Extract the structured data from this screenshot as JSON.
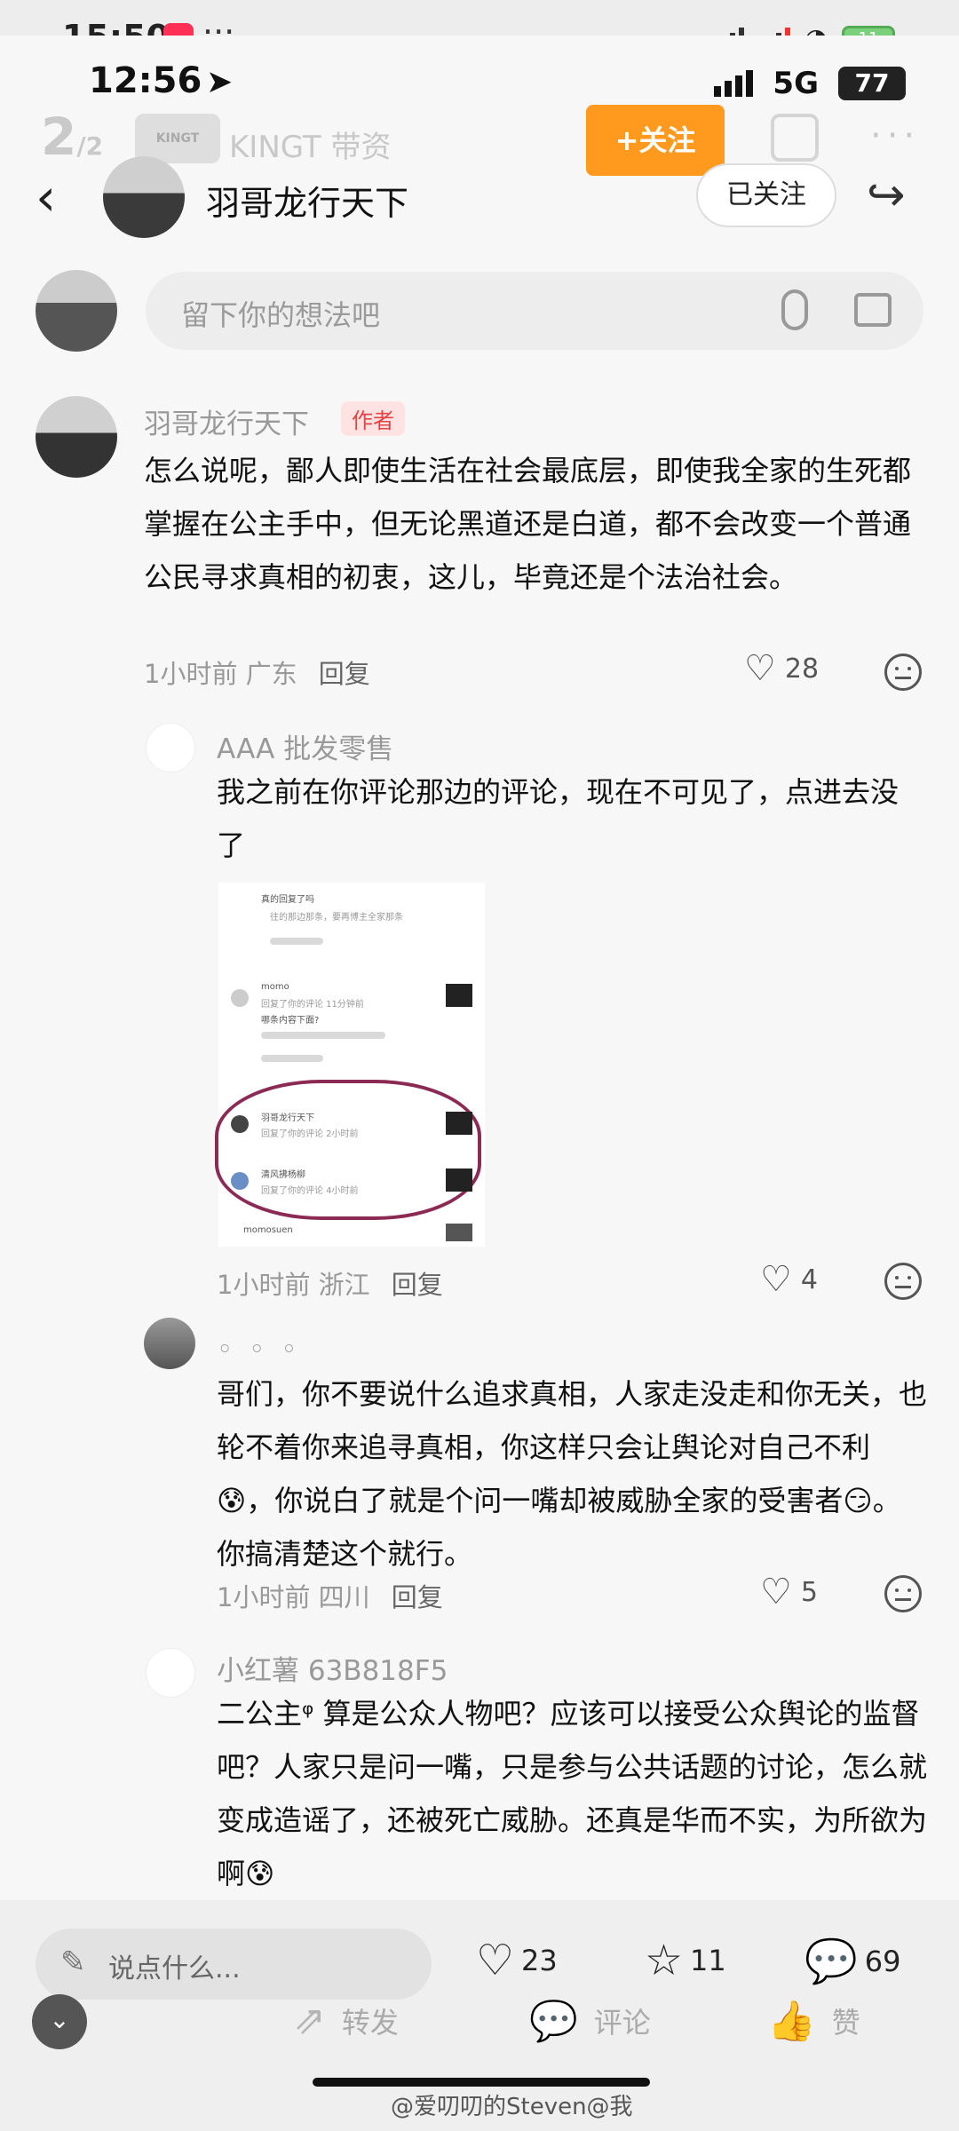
{
  "outer_status": {
    "time": "15:50",
    "dots": "···",
    "battery": "11"
  },
  "inner_status": {
    "time": "12:56",
    "network": "5G",
    "battery": "77"
  },
  "overlay_header": {
    "page_current": "2",
    "page_total": "/2",
    "logo_text": "KINGT",
    "account_name": "KINGT 带资",
    "follow_label": "+关注",
    "more_label": "···"
  },
  "nav": {
    "back": "‹",
    "author_name": "羽哥龙行天下",
    "followed_label": "已关注",
    "share": "↪"
  },
  "comment_box": {
    "placeholder": "留下你的想法吧"
  },
  "comments": [
    {
      "user": "羽哥龙行天下",
      "tag": "作者",
      "text": "怎么说呢，鄙人即使生活在社会最底层，即使我全家的生死都掌握在公主手中，但无论黑道还是白道，都不会改变一个普通公民寻求真相的初衷，这儿，毕竟还是个法治社会。",
      "time": "1小时前",
      "location": "广东",
      "reply": "回复",
      "likes": "28"
    },
    {
      "user": "AAA 批发零售",
      "text": "我之前在你评论那边的评论，现在不可见了，点进去没了",
      "time": "1小时前",
      "location": "浙江",
      "reply": "回复",
      "likes": "4",
      "embed": {
        "line1": "真的回复了吗",
        "line2": "往的那边那条，要再博主全家那条",
        "user1": "momo",
        "user1_sub": "回复了你的评论 11分钟前",
        "user1_text": "哪条内容下面?",
        "user2": "羽哥龙行天下",
        "user2_sub": "回复了你的评论 2小时前",
        "user3": "清风拂杨柳",
        "user3_sub": "回复了你的评论 4小时前",
        "user4": "momosuen"
      }
    },
    {
      "user": "◦ ◦ ◦",
      "text": "哥们，你不要说什么追求真相，人家走没走和你无关，也轮不着你来追寻真相，你这样只会让舆论对自己不利😰，你说白了就是个问一嘴却被威胁全家的受害者😏。你搞清楚这个就行。",
      "time": "1小时前",
      "location": "四川",
      "reply": "回复",
      "likes": "5"
    },
    {
      "user": "小红薯 63B818F5",
      "text": "二公主ᵠ 算是公众人物吧？应该可以接受公众舆论的监督吧？人家只是问一嘴，只是参与公共话题的讨论，怎么就变成造谣了，还被死亡威胁。还真是华而不实，为所欲为啊😰"
    }
  ],
  "bottom_bar": {
    "say_placeholder": "说点什么...",
    "likes": "23",
    "favorites": "11",
    "comments": "69",
    "collapse": "⌄",
    "forward_label": "转发",
    "comment_label": "评论",
    "like_label": "赞"
  },
  "watermark": "@爱叨叨的Steven@我"
}
